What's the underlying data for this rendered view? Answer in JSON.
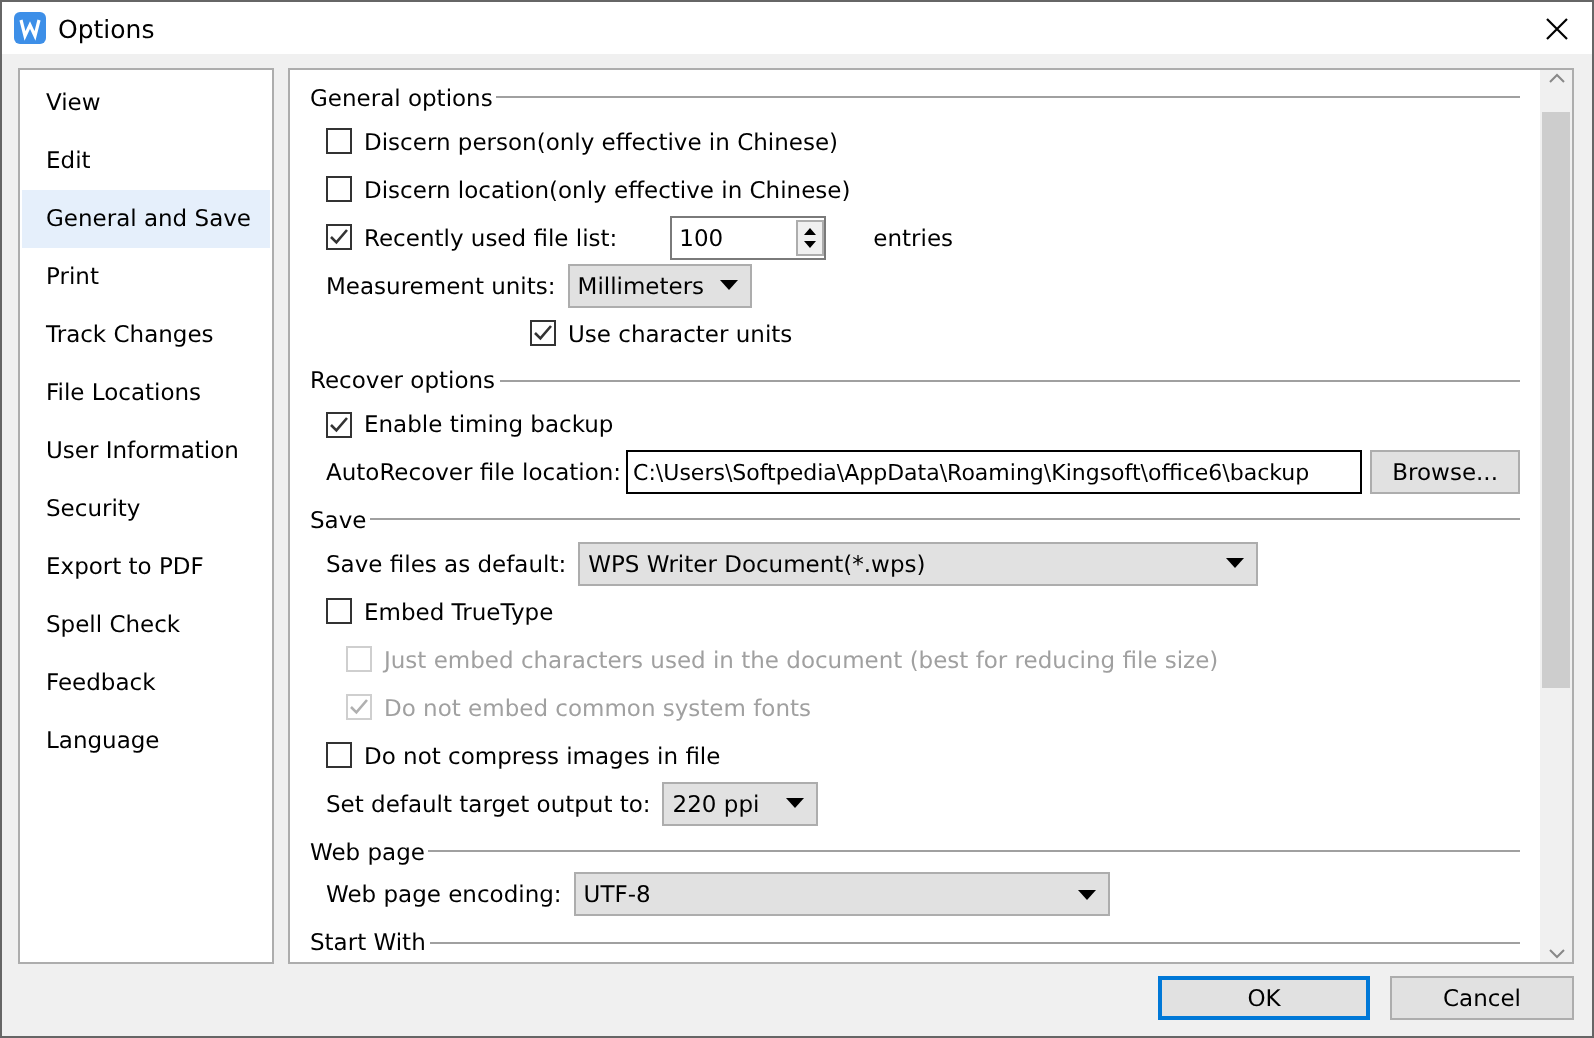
{
  "window": {
    "title": "Options"
  },
  "sidebar": {
    "items": [
      {
        "label": "View",
        "selected": false
      },
      {
        "label": "Edit",
        "selected": false
      },
      {
        "label": "General and Save",
        "selected": true
      },
      {
        "label": "Print",
        "selected": false
      },
      {
        "label": "Track Changes",
        "selected": false
      },
      {
        "label": "File Locations",
        "selected": false
      },
      {
        "label": "User Information",
        "selected": false
      },
      {
        "label": "Security",
        "selected": false
      },
      {
        "label": "Export to PDF",
        "selected": false
      },
      {
        "label": "Spell Check",
        "selected": false
      },
      {
        "label": "Feedback",
        "selected": false
      },
      {
        "label": "Language",
        "selected": false
      }
    ]
  },
  "sections": [
    {
      "title": "General options",
      "items": [
        {
          "kind": "checkbox",
          "label": "Discern person(only effective in Chinese)",
          "checked": false,
          "disabled": false
        },
        {
          "kind": "checkbox",
          "label": "Discern location(only effective in Chinese)",
          "checked": false,
          "disabled": false
        },
        {
          "kind": "spinner",
          "label": "Recently used file list:",
          "checked": true,
          "value": "100",
          "suffix": "entries"
        },
        {
          "kind": "compact-dropdown",
          "label": "Measurement units:",
          "value": "Millimeters",
          "children": [
            {
              "kind": "checkbox",
              "label": "Use character units",
              "checked": true,
              "disabled": false
            }
          ]
        }
      ]
    },
    {
      "title": "Recover options",
      "items": [
        {
          "kind": "checkbox",
          "label": "Enable timing backup",
          "checked": true,
          "disabled": false
        },
        {
          "kind": "path",
          "label": "AutoRecover file location:",
          "value": "C:\\Users\\Softpedia\\AppData\\Roaming\\Kingsoft\\office6\\backup",
          "button": "Browse..."
        }
      ]
    },
    {
      "title": "Save",
      "items": [
        {
          "kind": "wide-dropdown",
          "label": "Save files as default:",
          "value": "WPS Writer Document(*.wps)"
        },
        {
          "kind": "checkbox",
          "label": "Embed TrueType",
          "checked": false,
          "disabled": false,
          "children": [
            {
              "kind": "checkbox",
              "label": "Just embed characters used in the document (best for reducing file size)",
              "checked": false,
              "disabled": true
            },
            {
              "kind": "checkbox",
              "label": "Do not embed common system fonts",
              "checked": true,
              "disabled": true
            }
          ]
        },
        {
          "kind": "checkbox",
          "label": "Do not compress images in file",
          "checked": false,
          "disabled": false
        },
        {
          "kind": "compact-dropdown",
          "label": "Set default target output to:",
          "value": "220 ppi"
        }
      ]
    },
    {
      "title": "Web page",
      "items": [
        {
          "kind": "wide-dropdown",
          "label": "Web page encoding:",
          "value": "UTF-8"
        }
      ]
    },
    {
      "title": "Start With"
    }
  ],
  "buttons": [
    {
      "label": "OK",
      "default": true
    },
    {
      "label": "Cancel",
      "default": false
    }
  ]
}
